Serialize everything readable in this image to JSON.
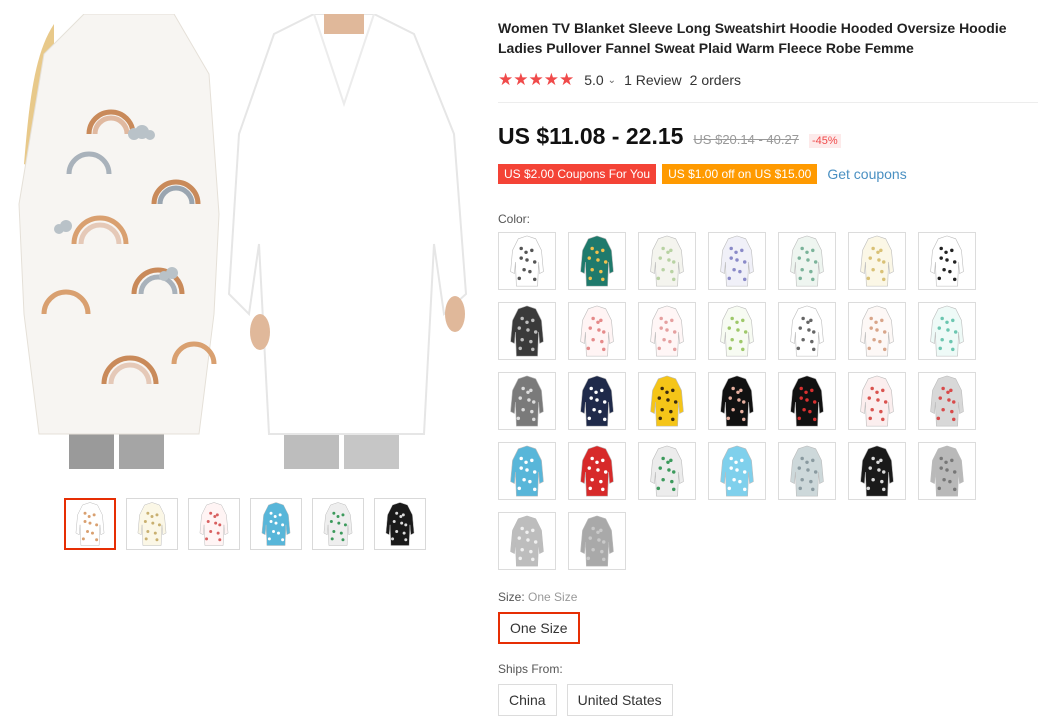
{
  "product": {
    "title": "Women TV Blanket Sleeve Long Sweatshirt Hoodie Hooded Oversize Hoodie Ladies Pullover Fannel Sweat Plaid Warm Fleece Robe Femme",
    "stars": "★★★★★",
    "rating_value": "5.0",
    "reviews": "1 Review",
    "orders": "2 orders"
  },
  "pricing": {
    "price": "US $11.08 - 22.15",
    "original_price": "US $20.14 - 40.27",
    "discount": "-45%"
  },
  "coupons": {
    "coupon_1": "US $2.00 Coupons For You",
    "coupon_2": "US $1.00 off on US $15.00",
    "get_coupons": "Get coupons"
  },
  "color": {
    "label": "Color:",
    "swatches": [
      {
        "bg": "#ffffff",
        "pattern": "#555555"
      },
      {
        "bg": "#1f7a6c",
        "pattern": "#f2c14e"
      },
      {
        "bg": "#f4f4ee",
        "pattern": "#b8d2a3"
      },
      {
        "bg": "#f0f0f8",
        "pattern": "#8a8ac8"
      },
      {
        "bg": "#eef5f0",
        "pattern": "#7bb39a"
      },
      {
        "bg": "#fbf7e6",
        "pattern": "#d9c176"
      },
      {
        "bg": "#ffffff",
        "pattern": "#222222"
      },
      {
        "bg": "#3a3a3a",
        "pattern": "#bdbdbd"
      },
      {
        "bg": "#fff4f4",
        "pattern": "#e58a8a"
      },
      {
        "bg": "#fff6f6",
        "pattern": "#e5a0a0"
      },
      {
        "bg": "#f7fbf2",
        "pattern": "#9ec86a"
      },
      {
        "bg": "#ffffff",
        "pattern": "#666666"
      },
      {
        "bg": "#fdf8f6",
        "pattern": "#d8a58a"
      },
      {
        "bg": "#eefaf7",
        "pattern": "#6cc6b0"
      },
      {
        "bg": "#7a7a7a",
        "pattern": "#dddddd"
      },
      {
        "bg": "#1f2a4a",
        "pattern": "#ffffff"
      },
      {
        "bg": "#f5c518",
        "pattern": "#3a2a10"
      },
      {
        "bg": "#111111",
        "pattern": "#e8b0a0"
      },
      {
        "bg": "#111111",
        "pattern": "#d93030"
      },
      {
        "bg": "#fbeeee",
        "pattern": "#d9534f"
      },
      {
        "bg": "#d8d8d8",
        "pattern": "#d84a4a"
      },
      {
        "bg": "#58b6d9",
        "pattern": "#ffffff"
      },
      {
        "bg": "#d72a2a",
        "pattern": "#ffffff"
      },
      {
        "bg": "#ececec",
        "pattern": "#3c9a5c"
      },
      {
        "bg": "#7fd0ec",
        "pattern": "#ffffff"
      },
      {
        "bg": "#cdd8da",
        "pattern": "#8a9aa0"
      },
      {
        "bg": "#1a1a1a",
        "pattern": "#dcdcdc"
      },
      {
        "bg": "#b9b9b9",
        "pattern": "#777777"
      },
      {
        "bg": "#bdbdbd",
        "pattern": "#f0f0f0"
      },
      {
        "bg": "#a9a9a9",
        "pattern": "#c9c9c9"
      }
    ]
  },
  "size": {
    "label": "Size:",
    "selected": "One Size",
    "options": [
      "One Size"
    ]
  },
  "ships_from": {
    "label": "Ships From:",
    "options": [
      "China",
      "United States"
    ]
  },
  "thumbnails": [
    {
      "bg": "#ffffff",
      "pattern": "#d9a070"
    },
    {
      "bg": "#fbf7e6",
      "pattern": "#c9b070"
    },
    {
      "bg": "#fff4f4",
      "pattern": "#d86060"
    },
    {
      "bg": "#58b6d9",
      "pattern": "#ffffff"
    },
    {
      "bg": "#eeeeee",
      "pattern": "#3c9a5c"
    },
    {
      "bg": "#1a1a1a",
      "pattern": "#dcdcdc"
    }
  ]
}
